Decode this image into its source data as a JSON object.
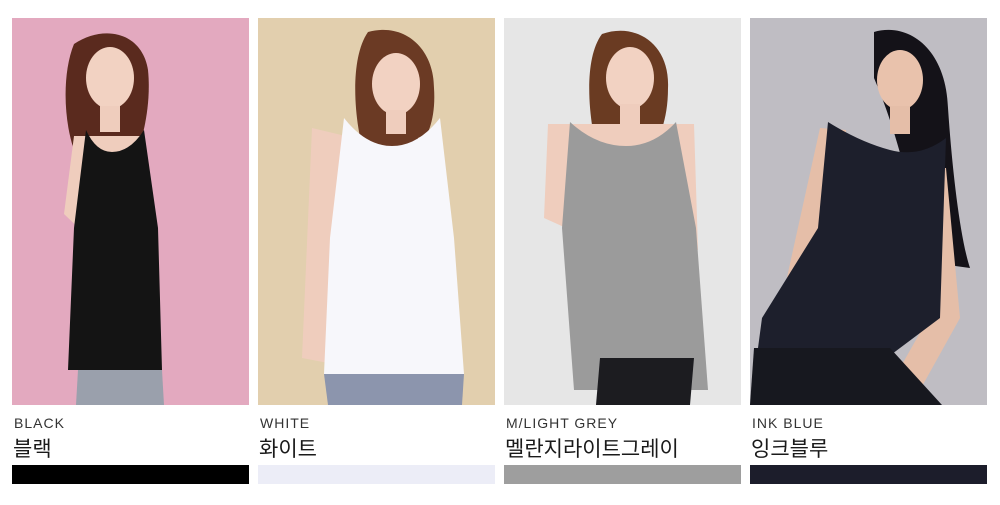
{
  "products": [
    {
      "label_en": "BLACK",
      "label_ko": "블랙",
      "swatch_color": "#000000",
      "background_color": "#e3a9bf",
      "garment_color": "#141414",
      "pants_color": "#9aa0ac",
      "hair_color": "#5a2a1e"
    },
    {
      "label_en": "WHITE",
      "label_ko": "화이트",
      "swatch_color": "#ecedf7",
      "background_color": "#e2cfae",
      "garment_color": "#f7f7fb",
      "pants_color": "#8c95ad",
      "hair_color": "#6b3a24"
    },
    {
      "label_en": "M/LIGHT GREY",
      "label_ko": "멜란지라이트그레이",
      "swatch_color": "#9e9e9e",
      "background_color": "#e6e6e6",
      "garment_color": "#9b9b9b",
      "pants_color": "#1c1c20",
      "hair_color": "#6a3b22"
    },
    {
      "label_en": "INK BLUE",
      "label_ko": "잉크블루",
      "swatch_color": "#1c1d2b",
      "background_color": "#bfbdc3",
      "garment_color": "#1d1f2c",
      "pants_color": "#17181f",
      "hair_color": "#141218"
    }
  ]
}
